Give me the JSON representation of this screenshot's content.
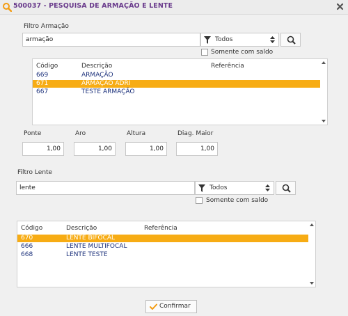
{
  "window": {
    "title": "500037 - PESQUISA DE ARMAÇÃO E LENTE"
  },
  "armacao": {
    "filter_label": "Filtro Armação",
    "search_value": "armação",
    "select_value": "Todos",
    "checkbox_label": "Somente com saldo",
    "columns": [
      "Código",
      "Descrição",
      "Referência"
    ],
    "rows": [
      {
        "codigo": "669",
        "descricao": "ARMAÇÃO",
        "referencia": ""
      },
      {
        "codigo": "671",
        "descricao": "ARMAÇÃO ADRI",
        "referencia": "",
        "selected": true
      },
      {
        "codigo": "667",
        "descricao": "TESTE ARMAÇÃO",
        "referencia": ""
      }
    ]
  },
  "medidas": {
    "ponte": {
      "label": "Ponte",
      "value": "1,00"
    },
    "aro": {
      "label": "Aro",
      "value": "1,00"
    },
    "altura": {
      "label": "Altura",
      "value": "1,00"
    },
    "diag_maior": {
      "label": "Diag. Maior",
      "value": "1,00"
    }
  },
  "lente": {
    "filter_label": "Filtro Lente",
    "search_value": "lente",
    "select_value": "Todos",
    "checkbox_label": "Somente com saldo",
    "columns": [
      "Código",
      "Descrição",
      "Referência"
    ],
    "rows": [
      {
        "codigo": "670",
        "descricao": "LENTE BIFOCAL",
        "referencia": "",
        "selected": true
      },
      {
        "codigo": "666",
        "descricao": "LENTE MULTIFOCAL",
        "referencia": ""
      },
      {
        "codigo": "668",
        "descricao": "LENTE TESTE",
        "referencia": ""
      }
    ]
  },
  "footer": {
    "confirm_label": "Confirmar"
  },
  "colors": {
    "title": "#6a3b8c",
    "selection": "#f7ac14",
    "row_text": "#1a2f7a",
    "icon_orange": "#f39c12"
  }
}
